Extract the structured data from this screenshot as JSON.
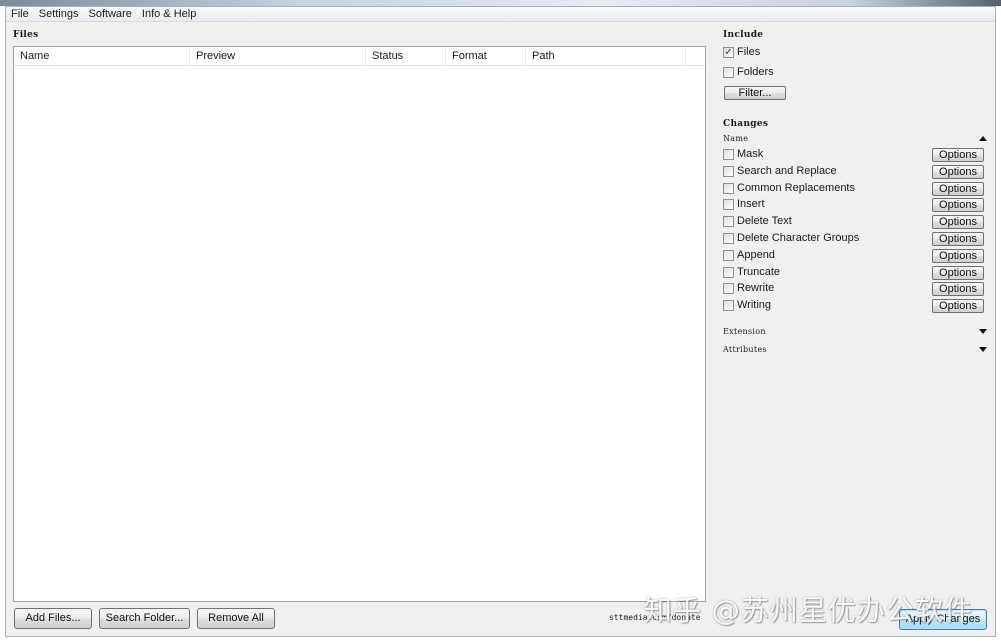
{
  "menu": [
    "File",
    "Settings",
    "Software",
    "Info & Help"
  ],
  "files": {
    "title": "Files",
    "columns": [
      "Name",
      "Preview",
      "Status",
      "Format",
      "Path"
    ]
  },
  "bottom": {
    "add_files": "Add Files...",
    "search_folder": "Search Folder...",
    "remove_all": "Remove All",
    "donate": "sttmedia.com/donate",
    "apply": "Apply Changes"
  },
  "include": {
    "title": "Include",
    "files_label": "Files",
    "files_checked": true,
    "folders_label": "Folders",
    "folders_checked": false,
    "filter_button": "Filter..."
  },
  "changes": {
    "title": "Changes",
    "name_section": "Name",
    "options_label": "Options",
    "items": [
      "Mask",
      "Search and Replace",
      "Common Replacements",
      "Insert",
      "Delete Text",
      "Delete Character Groups",
      "Append",
      "Truncate",
      "Rewrite",
      "Writing"
    ],
    "extension_section": "Extension",
    "attributes_section": "Attributes"
  },
  "watermark": "知乎 @苏州星优办公软件"
}
